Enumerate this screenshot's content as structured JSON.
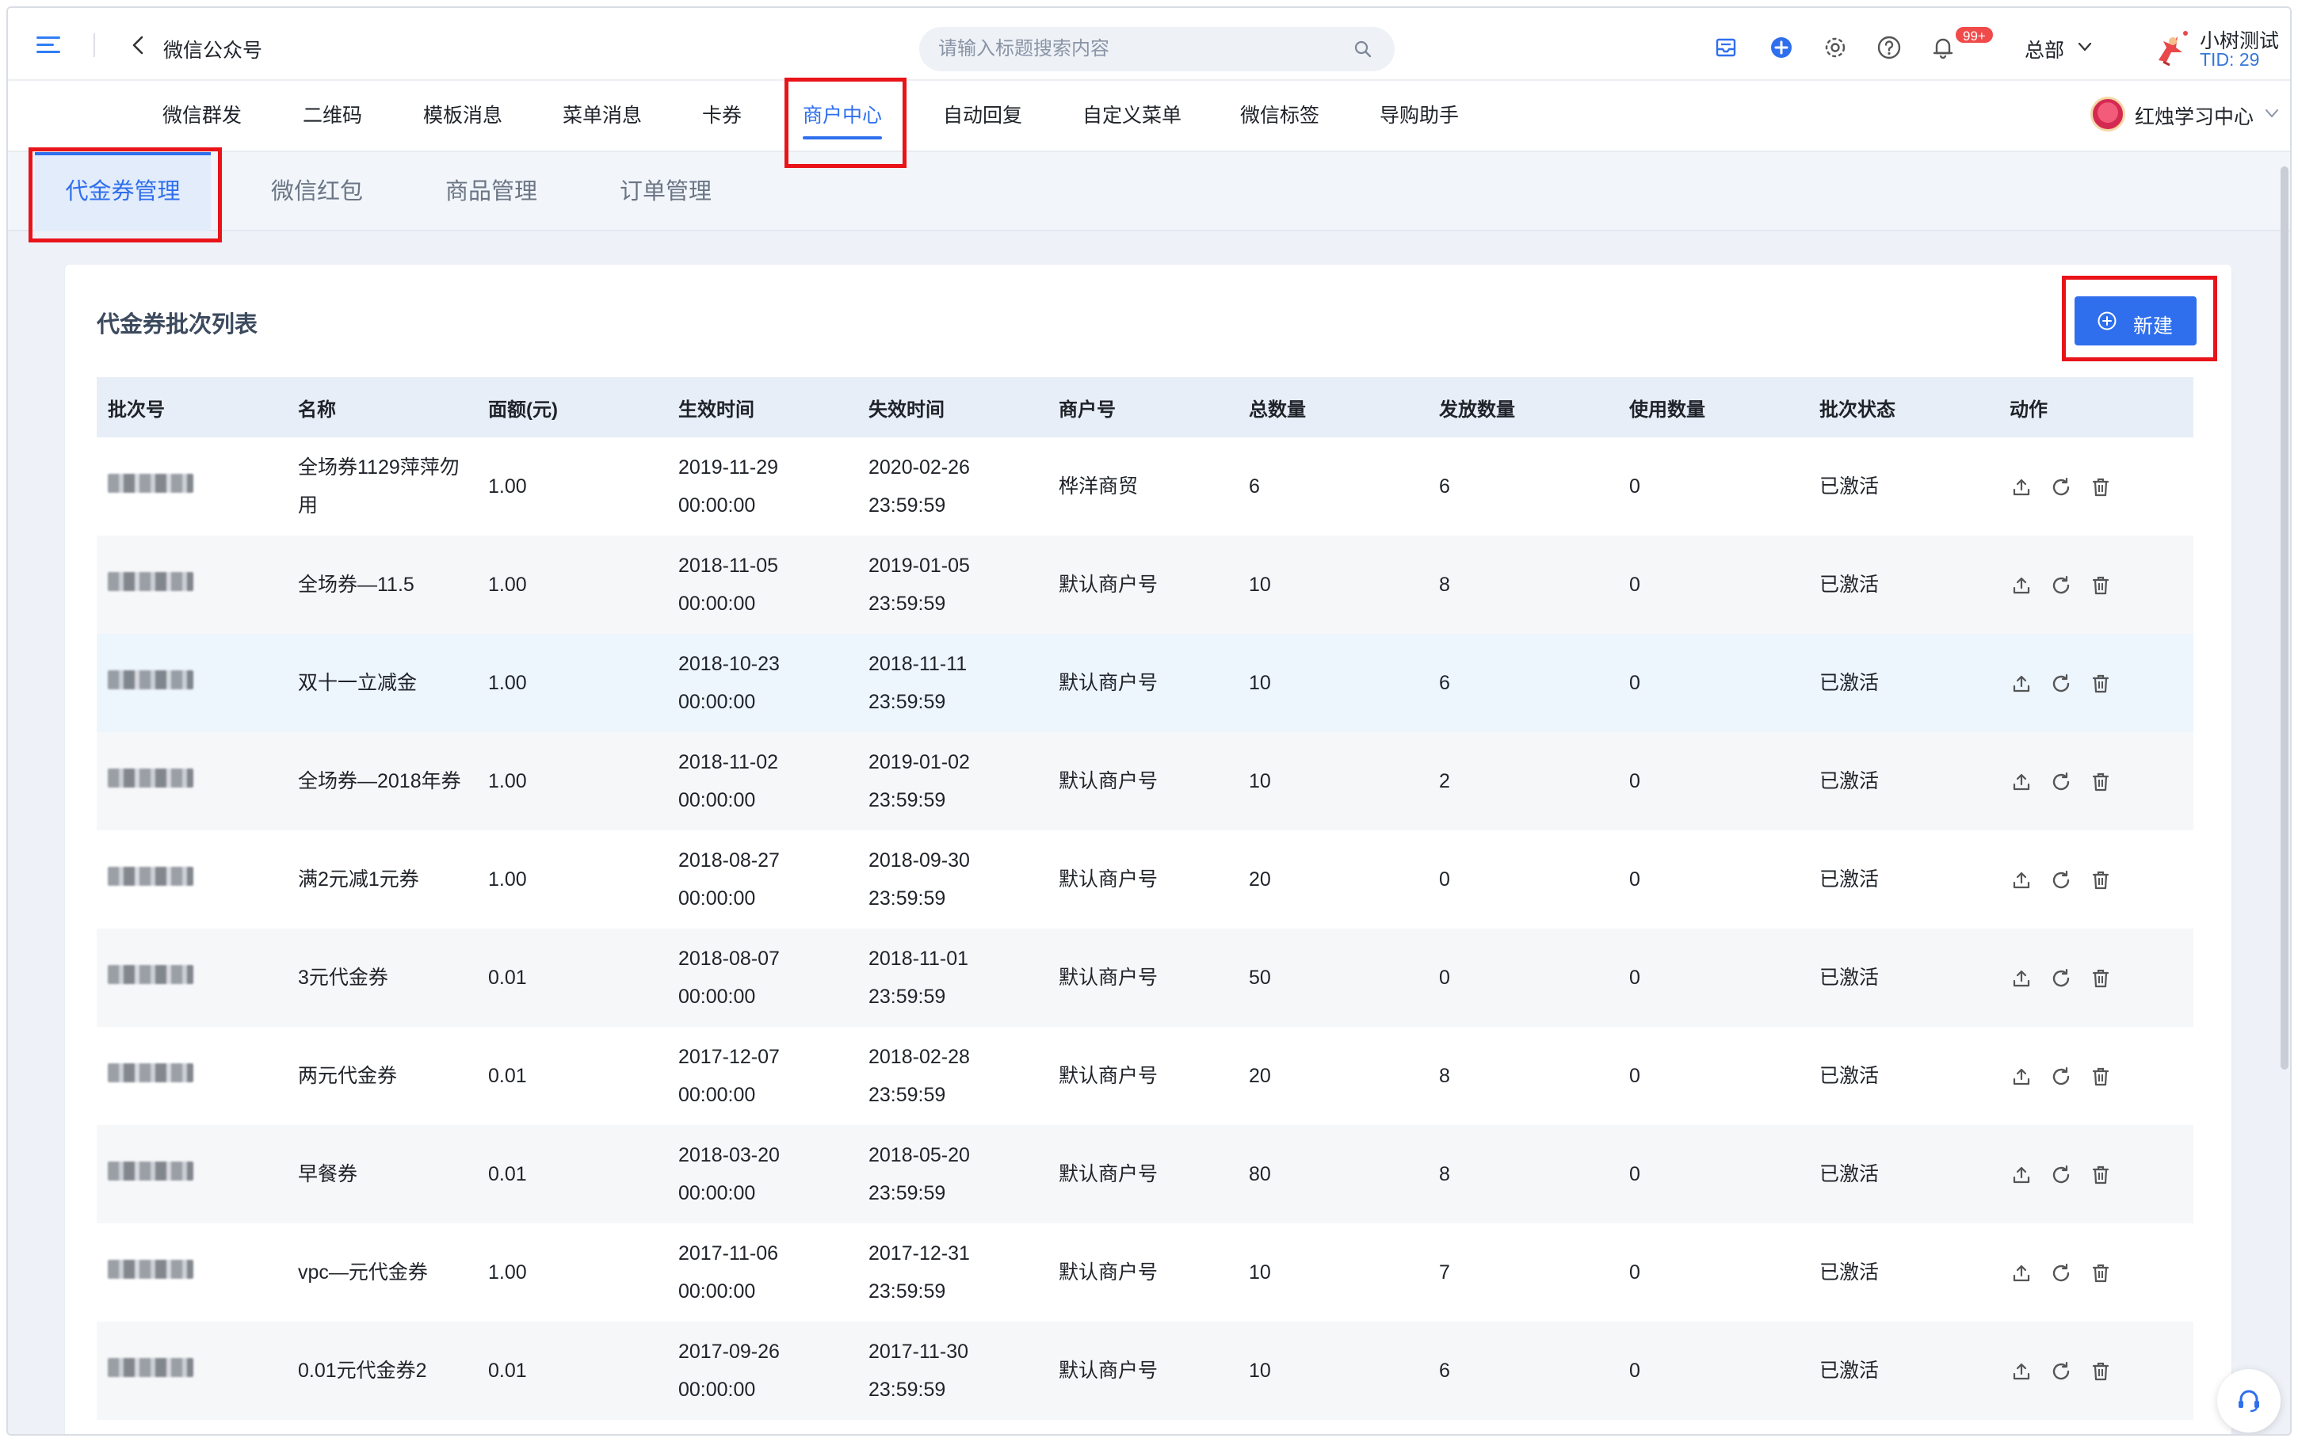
{
  "header": {
    "app_title": "微信公众号",
    "search_placeholder": "请输入标题搜索内容",
    "notification_badge": "99+",
    "org": "总部",
    "user_name": "小树测试",
    "user_tid": "TID: 29"
  },
  "nav": {
    "items": [
      "微信群发",
      "二维码",
      "模板消息",
      "菜单消息",
      "卡券",
      "商户中心",
      "自动回复",
      "自定义菜单",
      "微信标签",
      "导购助手"
    ],
    "active": "商户中心",
    "account_name": "红烛学习中心"
  },
  "subtabs": {
    "items": [
      "代金券管理",
      "微信红包",
      "商品管理",
      "订单管理"
    ],
    "active": "代金券管理"
  },
  "card": {
    "title": "代金券批次列表",
    "new_button": "新建"
  },
  "table": {
    "columns": [
      "批次号",
      "名称",
      "面额(元)",
      "生效时间",
      "失效时间",
      "商户号",
      "总数量",
      "发放数量",
      "使用数量",
      "批次状态",
      "动作"
    ],
    "rows": [
      {
        "name": "全场券1129萍萍勿用",
        "amount": "1.00",
        "start_date": "2019-11-29",
        "start_time": "00:00:00",
        "end_date": "2020-02-26",
        "end_time": "23:59:59",
        "merchant": "桦洋商贸",
        "total": "6",
        "issued": "6",
        "used": "0",
        "status": "已激活"
      },
      {
        "name": "全场券—11.5",
        "amount": "1.00",
        "start_date": "2018-11-05",
        "start_time": "00:00:00",
        "end_date": "2019-01-05",
        "end_time": "23:59:59",
        "merchant": "默认商户号",
        "total": "10",
        "issued": "8",
        "used": "0",
        "status": "已激活"
      },
      {
        "name": "双十一立减金",
        "amount": "1.00",
        "start_date": "2018-10-23",
        "start_time": "00:00:00",
        "end_date": "2018-11-11",
        "end_time": "23:59:59",
        "merchant": "默认商户号",
        "total": "10",
        "issued": "6",
        "used": "0",
        "status": "已激活"
      },
      {
        "name": "全场券—2018年券",
        "amount": "1.00",
        "start_date": "2018-11-02",
        "start_time": "00:00:00",
        "end_date": "2019-01-02",
        "end_time": "23:59:59",
        "merchant": "默认商户号",
        "total": "10",
        "issued": "2",
        "used": "0",
        "status": "已激活"
      },
      {
        "name": "满2元减1元券",
        "amount": "1.00",
        "start_date": "2018-08-27",
        "start_time": "00:00:00",
        "end_date": "2018-09-30",
        "end_time": "23:59:59",
        "merchant": "默认商户号",
        "total": "20",
        "issued": "0",
        "used": "0",
        "status": "已激活"
      },
      {
        "name": "3元代金券",
        "amount": "0.01",
        "start_date": "2018-08-07",
        "start_time": "00:00:00",
        "end_date": "2018-11-01",
        "end_time": "23:59:59",
        "merchant": "默认商户号",
        "total": "50",
        "issued": "0",
        "used": "0",
        "status": "已激活"
      },
      {
        "name": "两元代金券",
        "amount": "0.01",
        "start_date": "2017-12-07",
        "start_time": "00:00:00",
        "end_date": "2018-02-28",
        "end_time": "23:59:59",
        "merchant": "默认商户号",
        "total": "20",
        "issued": "8",
        "used": "0",
        "status": "已激活"
      },
      {
        "name": "早餐券",
        "amount": "0.01",
        "start_date": "2018-03-20",
        "start_time": "00:00:00",
        "end_date": "2018-05-20",
        "end_time": "23:59:59",
        "merchant": "默认商户号",
        "total": "80",
        "issued": "8",
        "used": "0",
        "status": "已激活"
      },
      {
        "name": "vpc—元代金券",
        "amount": "1.00",
        "start_date": "2017-11-06",
        "start_time": "00:00:00",
        "end_date": "2017-12-31",
        "end_time": "23:59:59",
        "merchant": "默认商户号",
        "total": "10",
        "issued": "7",
        "used": "0",
        "status": "已激活"
      },
      {
        "name": "0.01元代金券2",
        "amount": "0.01",
        "start_date": "2017-09-26",
        "start_time": "00:00:00",
        "end_date": "2017-11-30",
        "end_time": "23:59:59",
        "merchant": "默认商户号",
        "total": "10",
        "issued": "6",
        "used": "0",
        "status": "已激活"
      }
    ],
    "row_actions": [
      "upload-icon",
      "refresh-icon",
      "trash-icon"
    ]
  },
  "colors": {
    "accent": "#2f6fed",
    "highlight_box": "#e8141a",
    "badge": "#f04a4a"
  }
}
